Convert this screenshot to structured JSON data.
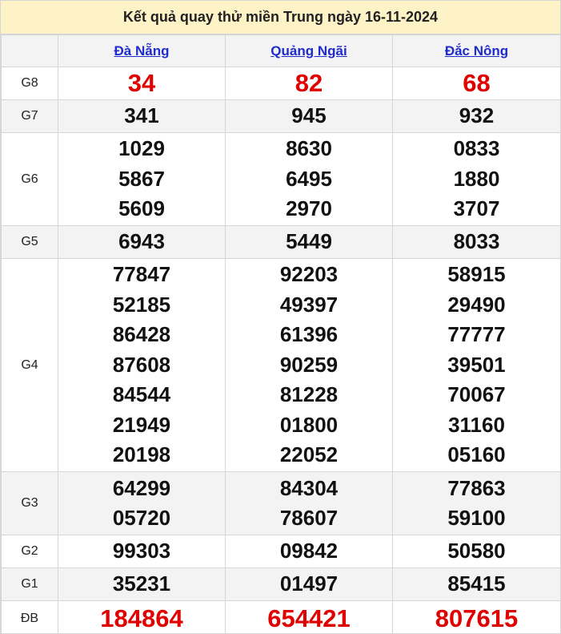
{
  "title": "Kết quả quay thử miền Trung ngày 16-11-2024",
  "provinces": [
    "Đà Nẵng",
    "Quảng Ngãi",
    "Đắc Nông"
  ],
  "prizes": {
    "G8": {
      "label": "G8",
      "values": [
        [
          "34"
        ],
        [
          "82"
        ],
        [
          "68"
        ]
      ]
    },
    "G7": {
      "label": "G7",
      "values": [
        [
          "341"
        ],
        [
          "945"
        ],
        [
          "932"
        ]
      ]
    },
    "G6": {
      "label": "G6",
      "values": [
        [
          "1029",
          "5867",
          "5609"
        ],
        [
          "8630",
          "6495",
          "2970"
        ],
        [
          "0833",
          "1880",
          "3707"
        ]
      ]
    },
    "G5": {
      "label": "G5",
      "values": [
        [
          "6943"
        ],
        [
          "5449"
        ],
        [
          "8033"
        ]
      ]
    },
    "G4": {
      "label": "G4",
      "values": [
        [
          "77847",
          "52185",
          "86428",
          "87608",
          "84544",
          "21949",
          "20198"
        ],
        [
          "92203",
          "49397",
          "61396",
          "90259",
          "81228",
          "01800",
          "22052"
        ],
        [
          "58915",
          "29490",
          "77777",
          "39501",
          "70067",
          "31160",
          "05160"
        ]
      ]
    },
    "G3": {
      "label": "G3",
      "values": [
        [
          "64299",
          "05720"
        ],
        [
          "84304",
          "78607"
        ],
        [
          "77863",
          "59100"
        ]
      ]
    },
    "G2": {
      "label": "G2",
      "values": [
        [
          "99303"
        ],
        [
          "09842"
        ],
        [
          "50580"
        ]
      ]
    },
    "G1": {
      "label": "G1",
      "values": [
        [
          "35231"
        ],
        [
          "01497"
        ],
        [
          "85415"
        ]
      ]
    },
    "DB": {
      "label": "ĐB",
      "values": [
        [
          "184864"
        ],
        [
          "654421"
        ],
        [
          "807615"
        ]
      ]
    }
  },
  "colors": {
    "title_bg": "#fef3c7",
    "link": "#1f2ccc",
    "highlight": "#e00000",
    "shade": "#f3f3f3",
    "border": "#d6d6d6"
  }
}
